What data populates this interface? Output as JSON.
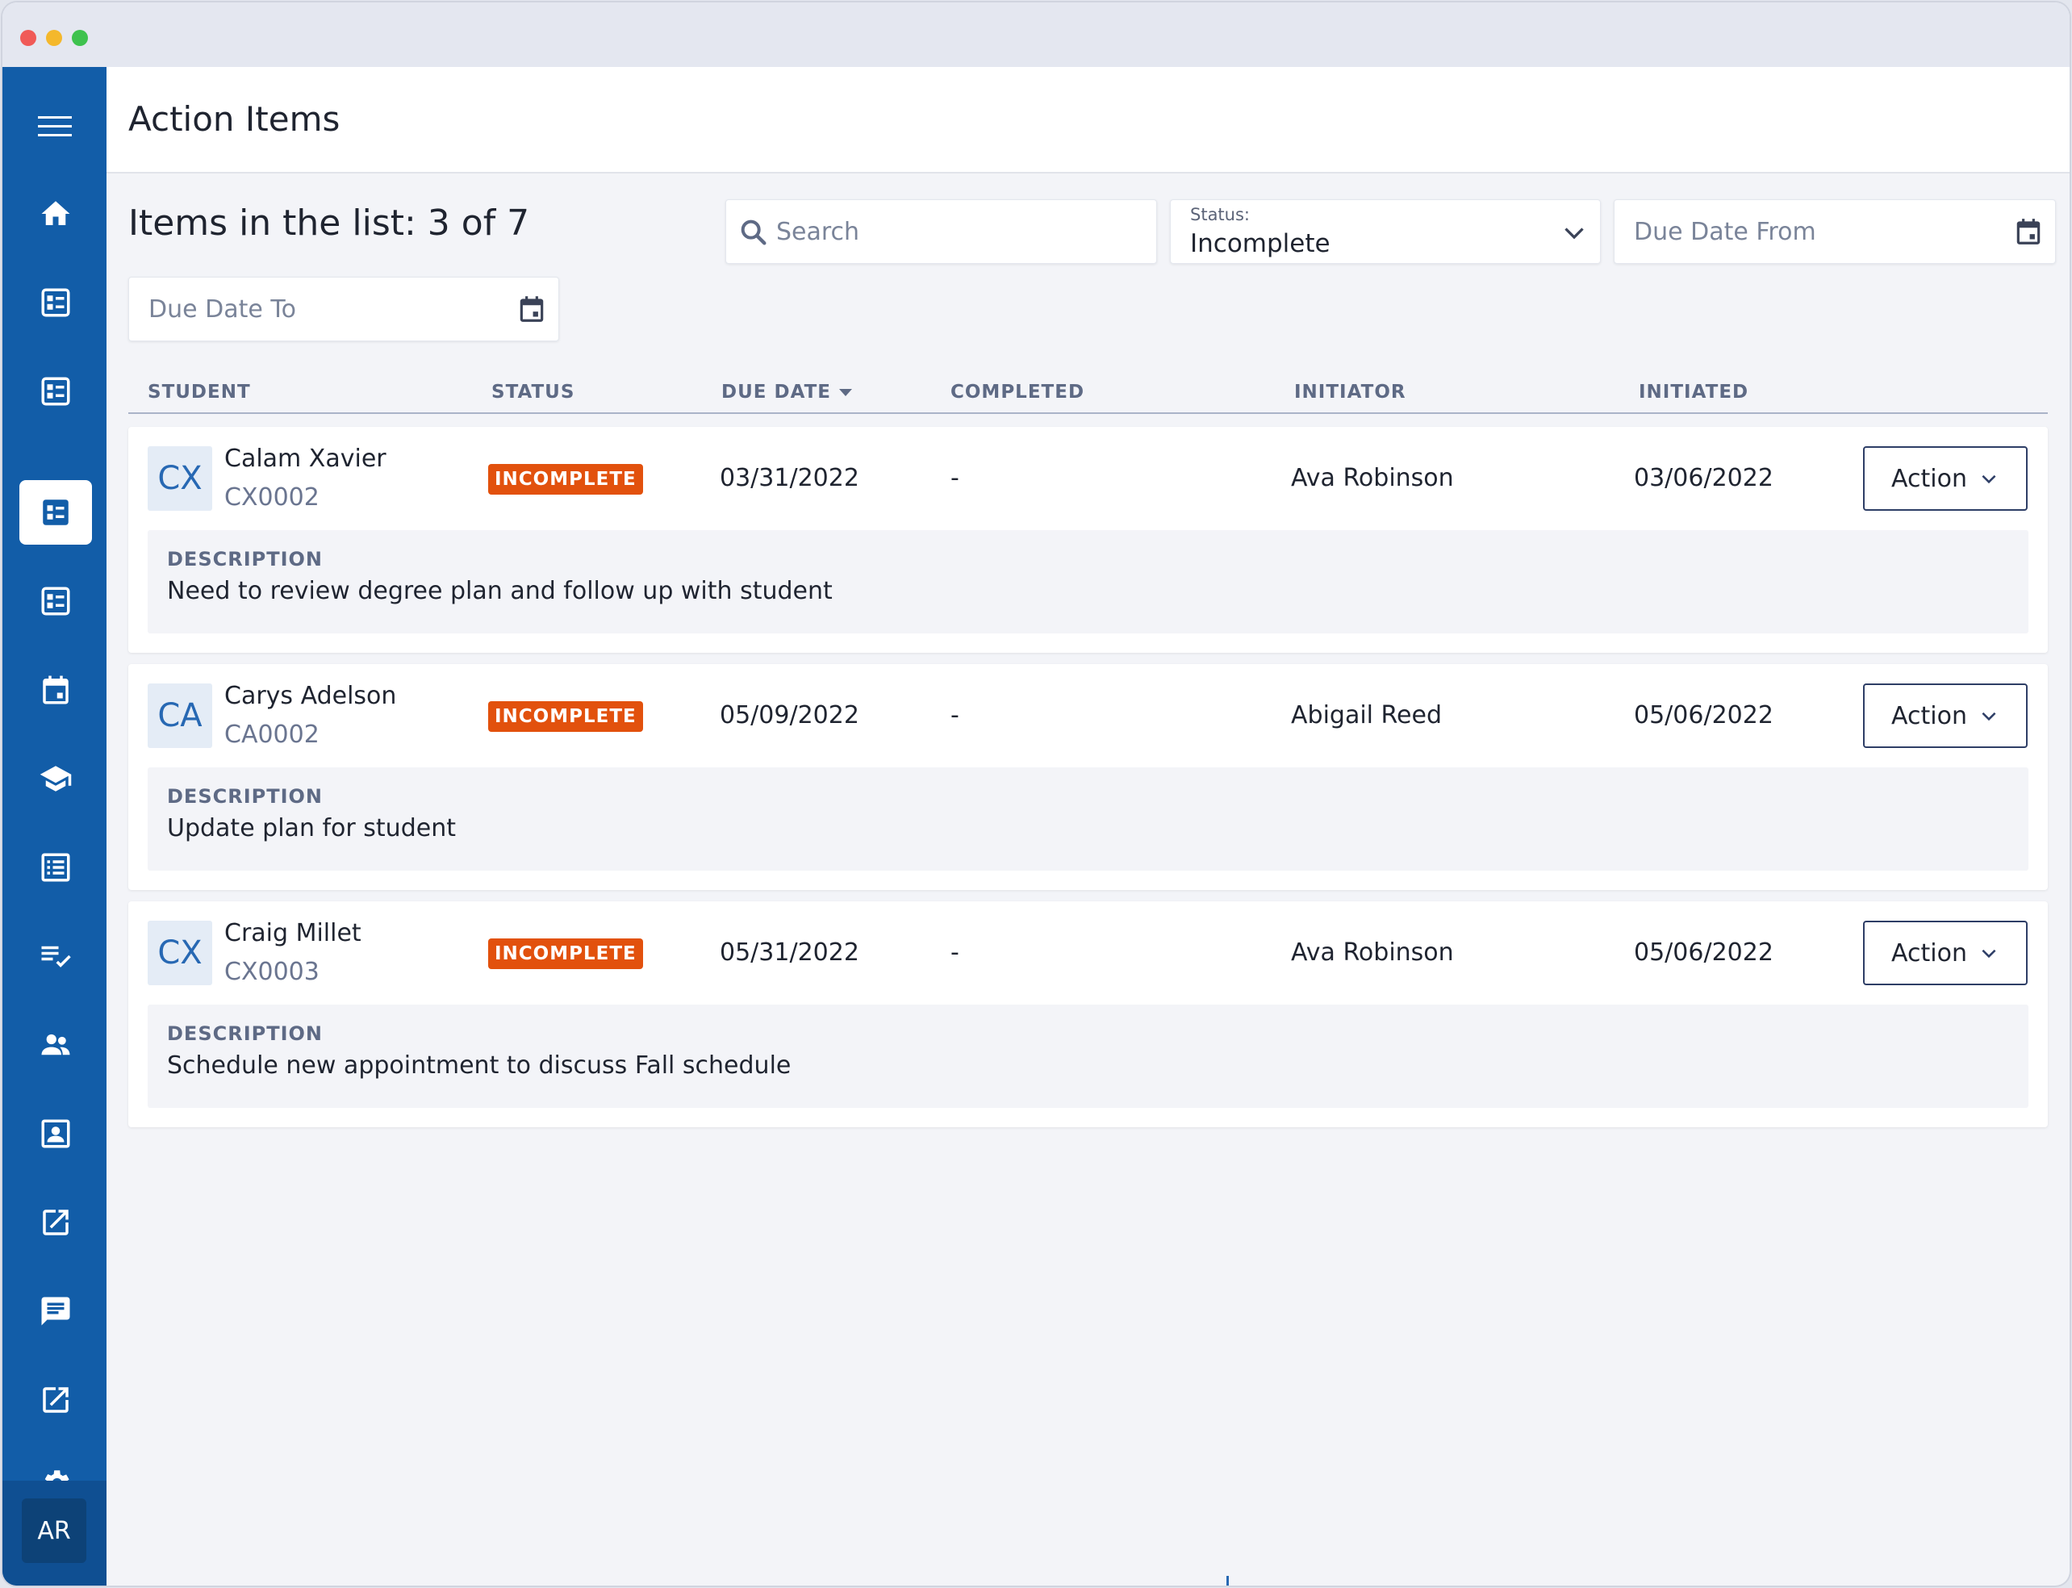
{
  "header": {
    "title": "Action Items"
  },
  "sidebar": {
    "menu_icon": "hamburger-icon",
    "items": [
      {
        "icon": "home-icon"
      },
      {
        "icon": "list-box-icon"
      },
      {
        "icon": "list-box-icon"
      },
      {
        "icon": "list-box-icon",
        "active": true
      },
      {
        "icon": "list-box-icon"
      },
      {
        "icon": "calendar-icon"
      },
      {
        "icon": "graduation-cap-icon"
      },
      {
        "icon": "list-alt-icon"
      },
      {
        "icon": "checklist-icon"
      },
      {
        "icon": "people-icon"
      },
      {
        "icon": "contact-card-icon"
      },
      {
        "icon": "open-external-icon"
      },
      {
        "icon": "chat-icon"
      },
      {
        "icon": "open-external-icon"
      },
      {
        "icon": "gear-icon"
      }
    ],
    "user_initials": "AR"
  },
  "toolbar": {
    "count_label": "Items in the list: 3 of 7",
    "search_placeholder": "Search",
    "status_label": "Status:",
    "status_value": "Incomplete",
    "due_from_placeholder": "Due Date From",
    "due_to_placeholder": "Due Date To"
  },
  "table": {
    "columns": [
      "STUDENT",
      "STATUS",
      "DUE DATE",
      "COMPLETED",
      "INITIATOR",
      "INITIATED"
    ],
    "description_label": "DESCRIPTION",
    "action_label": "Action",
    "rows": [
      {
        "initials": "CX",
        "name": "Calam Xavier",
        "id": "CX0002",
        "status": "INCOMPLETE",
        "due": "03/31/2022",
        "completed": "-",
        "initiator": "Ava Robinson",
        "initiated": "03/06/2022",
        "description": "Need to review degree plan and follow up with student"
      },
      {
        "initials": "CA",
        "name": "Carys Adelson",
        "id": "CA0002",
        "status": "INCOMPLETE",
        "due": "05/09/2022",
        "completed": "-",
        "initiator": "Abigail Reed",
        "initiated": "05/06/2022",
        "description": "Update plan for student"
      },
      {
        "initials": "CX",
        "name": "Craig Millet",
        "id": "CX0003",
        "status": "INCOMPLETE",
        "due": "05/31/2022",
        "completed": "-",
        "initiator": "Ava Robinson",
        "initiated": "05/06/2022",
        "description": "Schedule new appointment to discuss Fall schedule"
      }
    ]
  },
  "colors": {
    "sidebar": "#125da8",
    "badge": "#e2510d",
    "accent": "#2768b3"
  }
}
